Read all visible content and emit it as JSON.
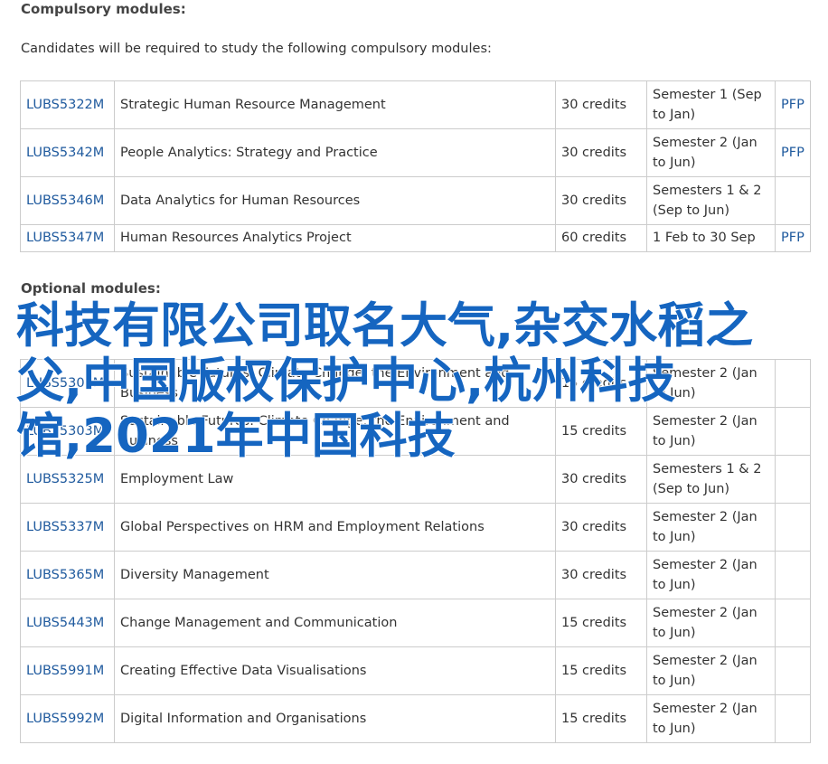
{
  "compulsory": {
    "heading": "Compulsory modules:",
    "intro": "Candidates will be required to study the following compulsory modules:",
    "rows": [
      {
        "code": "LUBS5322M",
        "title": "Strategic Human Resource Management",
        "credits": "30 credits",
        "semester": "Semester 1 (Sep to Jan)",
        "pfp": "PFP"
      },
      {
        "code": "LUBS5342M",
        "title": "People Analytics: Strategy and Practice",
        "credits": "30 credits",
        "semester": "Semester 2 (Jan to Jun)",
        "pfp": "PFP"
      },
      {
        "code": "LUBS5346M",
        "title": "Data Analytics for Human Resources",
        "credits": "30 credits",
        "semester": "Semesters 1 & 2 (Sep to Jun)",
        "pfp": ""
      },
      {
        "code": "LUBS5347M",
        "title": "Human Resources Analytics Project",
        "credits": "60 credits",
        "semester": "1 Feb to 30 Sep",
        "pfp": "PFP"
      }
    ]
  },
  "optional": {
    "heading": "Optional modules:",
    "rows": [
      {
        "code": "LUBS5301M",
        "title": "Sustainable Futures: Climate Change, the Environment and Business",
        "credits": "15 credits",
        "semester": "Semester 2 (Jan to Jun)"
      },
      {
        "code": "LUBS5303M",
        "title": "Sustainable Futures: Climate Change, the Environment and Business",
        "credits": "15 credits",
        "semester": "Semester 2 (Jan to Jun)"
      },
      {
        "code": "LUBS5325M",
        "title": "Employment Law",
        "credits": "30 credits",
        "semester": "Semesters 1 & 2 (Sep to Jun)"
      },
      {
        "code": "LUBS5337M",
        "title": "Global Perspectives on HRM and Employment Relations",
        "credits": "30 credits",
        "semester": "Semester 2 (Jan to Jun)"
      },
      {
        "code": "LUBS5365M",
        "title": "Diversity Management",
        "credits": "30 credits",
        "semester": "Semester 2 (Jan to Jun)"
      },
      {
        "code": "LUBS5443M",
        "title": "Change Management and Communication",
        "credits": "15 credits",
        "semester": "Semester 2 (Jan to Jun)"
      },
      {
        "code": "LUBS5991M",
        "title": "Creating Effective Data Visualisations",
        "credits": "15 credits",
        "semester": "Semester 2 (Jan to Jun)"
      },
      {
        "code": "LUBS5992M",
        "title": "Digital Information and Organisations",
        "credits": "15 credits",
        "semester": "Semester 2 (Jan to Jun)"
      }
    ]
  },
  "overlay_text": "科技有限公司取名大气,杂交水稻之父,中国版权保护中心,杭州科技馆,2021年中国科技",
  "colors": {
    "link": "#1f5a9e",
    "overlay": "#1565c0",
    "border": "#cccccc"
  }
}
